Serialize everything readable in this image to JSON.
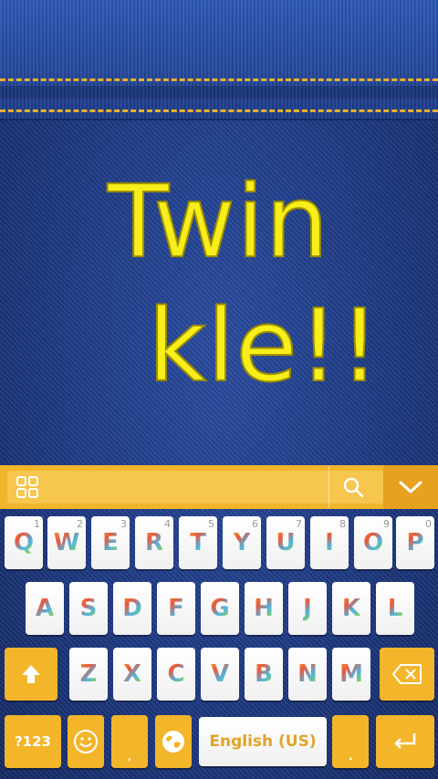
{
  "background": {
    "colors": {
      "denim": "#1d3a86",
      "stitch": "#e7b02c",
      "accent": "#f3b52a"
    }
  },
  "title": {
    "line1": "Twin",
    "line2": "kle!!"
  },
  "toolbar": {
    "grid_icon": "grid-icon",
    "search_icon": "search-icon",
    "collapse_icon": "chevron-down-icon"
  },
  "keyboard": {
    "row1": [
      {
        "letter": "Q",
        "hint": "1"
      },
      {
        "letter": "W",
        "hint": "2"
      },
      {
        "letter": "E",
        "hint": "3"
      },
      {
        "letter": "R",
        "hint": "4"
      },
      {
        "letter": "T",
        "hint": "5"
      },
      {
        "letter": "Y",
        "hint": "6"
      },
      {
        "letter": "U",
        "hint": "7"
      },
      {
        "letter": "I",
        "hint": "8"
      },
      {
        "letter": "O",
        "hint": "9"
      },
      {
        "letter": "P",
        "hint": "0"
      }
    ],
    "row2": [
      "A",
      "S",
      "D",
      "F",
      "G",
      "H",
      "J",
      "K",
      "L"
    ],
    "row3": [
      "Z",
      "X",
      "C",
      "V",
      "B",
      "N",
      "M"
    ],
    "symbols_label": "?123",
    "space_label": "English (US)",
    "shift_icon": "shift-arrow-icon",
    "backspace_icon": "backspace-icon",
    "emoji_icon": "emoji-icon",
    "globe_icon": "globe-icon",
    "enter_icon": "enter-icon"
  }
}
